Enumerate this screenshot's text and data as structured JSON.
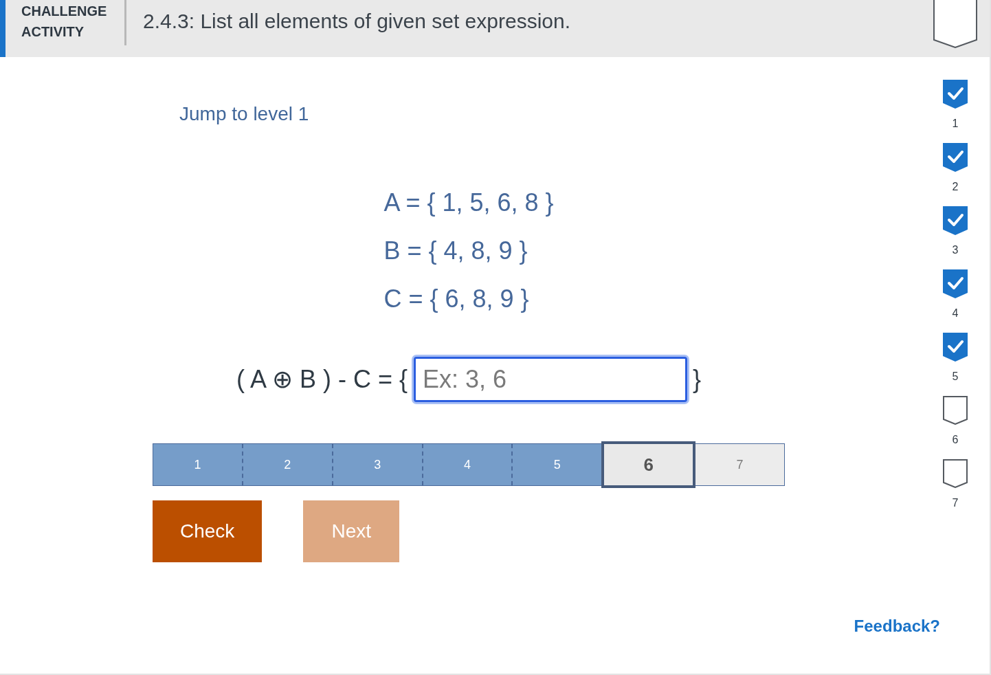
{
  "header": {
    "label": "CHALLENGE ACTIVITY",
    "title": "2.4.3: List all elements of given set expression.",
    "completed": false
  },
  "jump_link": "Jump to level 1",
  "sets": [
    "A = { 1, 5, 6, 8 }",
    "B = { 4, 8, 9 }",
    "C = { 6, 8, 9 }"
  ],
  "question": {
    "prefix": "( A ⊕ B ) - C = {",
    "answer": {
      "placeholder": "Ex: 3, 6",
      "focused": true
    },
    "suffix": "}"
  },
  "levels": [
    {
      "label": "1",
      "done": true,
      "selected": false
    },
    {
      "label": "2",
      "done": true,
      "selected": false
    },
    {
      "label": "3",
      "done": true,
      "selected": false
    },
    {
      "label": "4",
      "done": true,
      "selected": false
    },
    {
      "label": "5",
      "done": true,
      "selected": false
    },
    {
      "label": "6",
      "done": false,
      "selected": true
    },
    {
      "label": "7",
      "done": false,
      "selected": false
    }
  ],
  "buttons": [
    {
      "label": "Check",
      "disabled": false
    },
    {
      "label": "Next",
      "disabled": true
    }
  ],
  "level_badges": [
    {
      "label": "1",
      "checked": true
    },
    {
      "label": "2",
      "checked": true
    },
    {
      "label": "3",
      "checked": true
    },
    {
      "label": "4",
      "checked": true
    },
    {
      "label": "5",
      "checked": true
    },
    {
      "label": "6",
      "checked": false
    },
    {
      "label": "7",
      "checked": false
    }
  ],
  "feedback_link": "Feedback?"
}
